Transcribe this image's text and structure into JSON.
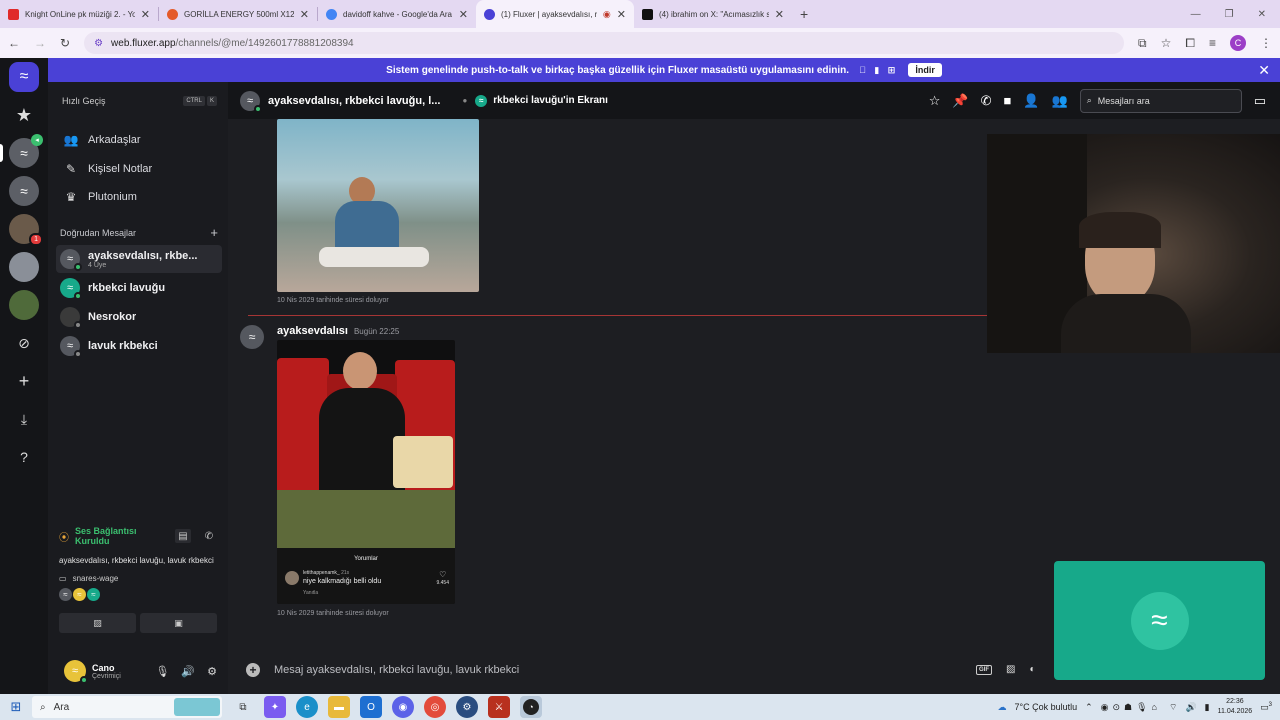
{
  "browser": {
    "tabs": [
      {
        "title": "Knight OnLine pk müziği 2. - Yo",
        "color": "#e02a2a",
        "active": false
      },
      {
        "title": "GORİLLA ENERGY 500ml X12 E",
        "color": "#e45a2a",
        "active": false
      },
      {
        "title": "davidoff kahve - Google'da Ara",
        "color": "#4285f4",
        "active": false
      },
      {
        "title": "(1) Fluxer | ayaksevdalısı, rk",
        "color": "#4a41d6",
        "active": true
      },
      {
        "title": "(4) ibrahim on X: \"Acımasızlık s",
        "color": "#111111",
        "active": false
      }
    ],
    "url_host": "web.fluxer.app",
    "url_path": "/channels/@me/1492601778881208394"
  },
  "banner": {
    "text": "Sistem genelinde push-to-talk ve birkaç başka güzellik için Fluxer masaüstü uygulamasını edinin.",
    "os_icons": "   ",
    "button": "İndir",
    "close": "✕"
  },
  "rail": {
    "home_icon": "≈",
    "items": [
      {
        "name": "favorites-star-icon",
        "glyph": "★"
      },
      {
        "name": "server-fluxer",
        "glyph": "≈"
      },
      {
        "name": "server-fluxer-2",
        "glyph": "≈"
      },
      {
        "name": "server-avatar-1",
        "glyph": "",
        "badge": "1"
      },
      {
        "name": "server-avatar-2",
        "glyph": ""
      },
      {
        "name": "server-avatar-3",
        "glyph": ""
      }
    ],
    "bottom": [
      "⊘",
      "+",
      "⤓",
      "?"
    ]
  },
  "sidebar": {
    "quick_label": "Hızlı Geçiş",
    "kbd": [
      "CTRL",
      "K"
    ],
    "nav": [
      {
        "label": "Arkadaşlar",
        "icon": "friends-icon",
        "glyph": "👥"
      },
      {
        "label": "Kişisel Notlar",
        "icon": "notes-icon",
        "glyph": "✎"
      },
      {
        "label": "Plutonium",
        "icon": "crown-icon",
        "glyph": "♛"
      }
    ],
    "dm_header": "Doğrudan Mesajlar",
    "dm_add": "+",
    "dms": [
      {
        "name": "ayaksevdalısı, rkbe...",
        "sub": "4 Üye",
        "selected": true,
        "color": "#55585f",
        "status": "#3bbf6f"
      },
      {
        "name": "rkbekci lavuğu",
        "sub": "",
        "selected": false,
        "color": "#17a98a",
        "status": "#3bbf6f"
      },
      {
        "name": "Nesrokor",
        "sub": "",
        "selected": false,
        "color": "#3a3a3a",
        "status": "#888888"
      },
      {
        "name": "lavuk rkbekci",
        "sub": "",
        "selected": false,
        "color": "#55585f",
        "status": "#888888"
      }
    ]
  },
  "voice": {
    "status": "Ses Bağlantısı Kuruldu",
    "members": "ayaksevdalısı, rkbekci lavuğu, lavuk rkbekci",
    "server": "snares-wage"
  },
  "user": {
    "name": "Cano",
    "status": "Çevrimiçi"
  },
  "header": {
    "title": "ayaksevdalısı, rkbekci lavuğu, l...",
    "screen_share": "rkbekci lavuğu'in Ekranı",
    "search_placeholder": "Mesajları ara"
  },
  "messages": {
    "expire1": "10 Nis 2029 tarihinde süresi doluyor",
    "author": "ayaksevdalısı",
    "time": "Bugün 22:25",
    "expire2": "10 Nis 2029 tarihinde süresi doluyor",
    "embed": {
      "comments_title": "Yorumlar",
      "commenter": "letithappenamk_",
      "ago": "21s",
      "comment": "niye kalkmadığı belli oldu",
      "reply": "Yanıtla",
      "likes": "9.454"
    }
  },
  "composer": {
    "placeholder": "Mesaj ayaksevdalısı, rkbekci lavuğu, lavuk rkbekci",
    "gif": "GIF"
  },
  "taskbar": {
    "search": "Ara",
    "weather": "7°C  Çok bulutlu",
    "time": "22:36",
    "date": "11.04.2026",
    "notif": "3"
  },
  "colors": {
    "accent": "#4a41d6",
    "fluxer_green": "#17a98a",
    "online": "#3bbf6f"
  }
}
